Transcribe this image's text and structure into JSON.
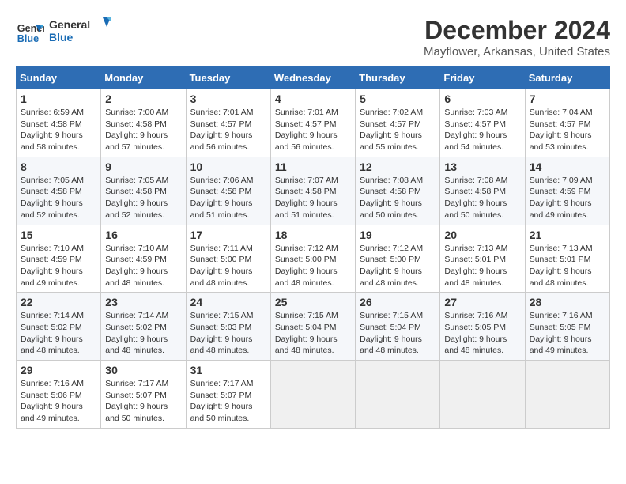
{
  "logo": {
    "line1": "General",
    "line2": "Blue"
  },
  "title": "December 2024",
  "subtitle": "Mayflower, Arkansas, United States",
  "days_of_week": [
    "Sunday",
    "Monday",
    "Tuesday",
    "Wednesday",
    "Thursday",
    "Friday",
    "Saturday"
  ],
  "weeks": [
    [
      {
        "day": "1",
        "sunrise": "6:59 AM",
        "sunset": "4:58 PM",
        "daylight": "9 hours and 58 minutes."
      },
      {
        "day": "2",
        "sunrise": "7:00 AM",
        "sunset": "4:58 PM",
        "daylight": "9 hours and 57 minutes."
      },
      {
        "day": "3",
        "sunrise": "7:01 AM",
        "sunset": "4:57 PM",
        "daylight": "9 hours and 56 minutes."
      },
      {
        "day": "4",
        "sunrise": "7:01 AM",
        "sunset": "4:57 PM",
        "daylight": "9 hours and 56 minutes."
      },
      {
        "day": "5",
        "sunrise": "7:02 AM",
        "sunset": "4:57 PM",
        "daylight": "9 hours and 55 minutes."
      },
      {
        "day": "6",
        "sunrise": "7:03 AM",
        "sunset": "4:57 PM",
        "daylight": "9 hours and 54 minutes."
      },
      {
        "day": "7",
        "sunrise": "7:04 AM",
        "sunset": "4:57 PM",
        "daylight": "9 hours and 53 minutes."
      }
    ],
    [
      {
        "day": "8",
        "sunrise": "7:05 AM",
        "sunset": "4:58 PM",
        "daylight": "9 hours and 52 minutes."
      },
      {
        "day": "9",
        "sunrise": "7:05 AM",
        "sunset": "4:58 PM",
        "daylight": "9 hours and 52 minutes."
      },
      {
        "day": "10",
        "sunrise": "7:06 AM",
        "sunset": "4:58 PM",
        "daylight": "9 hours and 51 minutes."
      },
      {
        "day": "11",
        "sunrise": "7:07 AM",
        "sunset": "4:58 PM",
        "daylight": "9 hours and 51 minutes."
      },
      {
        "day": "12",
        "sunrise": "7:08 AM",
        "sunset": "4:58 PM",
        "daylight": "9 hours and 50 minutes."
      },
      {
        "day": "13",
        "sunrise": "7:08 AM",
        "sunset": "4:58 PM",
        "daylight": "9 hours and 50 minutes."
      },
      {
        "day": "14",
        "sunrise": "7:09 AM",
        "sunset": "4:59 PM",
        "daylight": "9 hours and 49 minutes."
      }
    ],
    [
      {
        "day": "15",
        "sunrise": "7:10 AM",
        "sunset": "4:59 PM",
        "daylight": "9 hours and 49 minutes."
      },
      {
        "day": "16",
        "sunrise": "7:10 AM",
        "sunset": "4:59 PM",
        "daylight": "9 hours and 48 minutes."
      },
      {
        "day": "17",
        "sunrise": "7:11 AM",
        "sunset": "5:00 PM",
        "daylight": "9 hours and 48 minutes."
      },
      {
        "day": "18",
        "sunrise": "7:12 AM",
        "sunset": "5:00 PM",
        "daylight": "9 hours and 48 minutes."
      },
      {
        "day": "19",
        "sunrise": "7:12 AM",
        "sunset": "5:00 PM",
        "daylight": "9 hours and 48 minutes."
      },
      {
        "day": "20",
        "sunrise": "7:13 AM",
        "sunset": "5:01 PM",
        "daylight": "9 hours and 48 minutes."
      },
      {
        "day": "21",
        "sunrise": "7:13 AM",
        "sunset": "5:01 PM",
        "daylight": "9 hours and 48 minutes."
      }
    ],
    [
      {
        "day": "22",
        "sunrise": "7:14 AM",
        "sunset": "5:02 PM",
        "daylight": "9 hours and 48 minutes."
      },
      {
        "day": "23",
        "sunrise": "7:14 AM",
        "sunset": "5:02 PM",
        "daylight": "9 hours and 48 minutes."
      },
      {
        "day": "24",
        "sunrise": "7:15 AM",
        "sunset": "5:03 PM",
        "daylight": "9 hours and 48 minutes."
      },
      {
        "day": "25",
        "sunrise": "7:15 AM",
        "sunset": "5:04 PM",
        "daylight": "9 hours and 48 minutes."
      },
      {
        "day": "26",
        "sunrise": "7:15 AM",
        "sunset": "5:04 PM",
        "daylight": "9 hours and 48 minutes."
      },
      {
        "day": "27",
        "sunrise": "7:16 AM",
        "sunset": "5:05 PM",
        "daylight": "9 hours and 48 minutes."
      },
      {
        "day": "28",
        "sunrise": "7:16 AM",
        "sunset": "5:05 PM",
        "daylight": "9 hours and 49 minutes."
      }
    ],
    [
      {
        "day": "29",
        "sunrise": "7:16 AM",
        "sunset": "5:06 PM",
        "daylight": "9 hours and 49 minutes."
      },
      {
        "day": "30",
        "sunrise": "7:17 AM",
        "sunset": "5:07 PM",
        "daylight": "9 hours and 50 minutes."
      },
      {
        "day": "31",
        "sunrise": "7:17 AM",
        "sunset": "5:07 PM",
        "daylight": "9 hours and 50 minutes."
      },
      null,
      null,
      null,
      null
    ]
  ],
  "labels": {
    "sunrise": "Sunrise:",
    "sunset": "Sunset:",
    "daylight": "Daylight:"
  }
}
